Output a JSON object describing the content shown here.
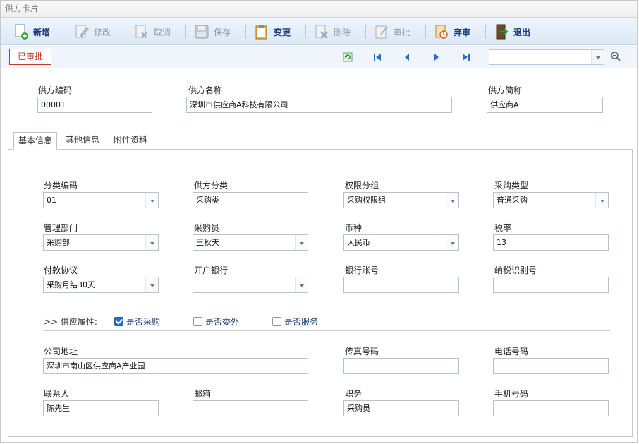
{
  "window": {
    "title": "供方卡片"
  },
  "toolbar": {
    "new": "新增",
    "edit": "修改",
    "cancel": "取消",
    "save": "保存",
    "change": "变更",
    "delete": "删除",
    "approve": "审批",
    "unapprove": "弃审",
    "exit": "退出"
  },
  "status": {
    "badge": "已审批"
  },
  "header": {
    "code_label": "供方编码",
    "code_value": "00001",
    "name_label": "供方名称",
    "name_value": "深圳市供应商A科技有限公司",
    "short_label": "供方简称",
    "short_value": "供应商A"
  },
  "tabs": [
    "基本信息",
    "其他信息",
    "附件资料"
  ],
  "basic": {
    "category_code_label": "分类编码",
    "category_code_value": "01",
    "category_label": "供方分类",
    "category_value": "采购类",
    "perm_group_label": "权限分组",
    "perm_group_value": "采购权限组",
    "purchase_type_label": "采购类型",
    "purchase_type_value": "普通采购",
    "dept_label": "管理部门",
    "dept_value": "采购部",
    "buyer_label": "采购员",
    "buyer_value": "王秋天",
    "currency_label": "币种",
    "currency_value": "人民币",
    "tax_label": "税率",
    "tax_value": "13",
    "payment_label": "付款协议",
    "payment_value": "采购月结30天",
    "bank_label": "开户银行",
    "bank_value": "",
    "account_label": "银行账号",
    "account_value": "",
    "taxid_label": "纳税识别号",
    "taxid_value": "",
    "attr_label": ">> 供应属性:",
    "attr_purchase": "是否采购",
    "attr_outsource": "是否委外",
    "attr_service": "是否服务",
    "address_label": "公司地址",
    "address_value": "深圳市南山区供应商A产业园",
    "fax_label": "传真号码",
    "fax_value": "",
    "phone_label": "电话号码",
    "phone_value": "",
    "contact_label": "联系人",
    "contact_value": "陈先生",
    "email_label": "邮箱",
    "email_value": "",
    "title_label": "职务",
    "title_value": "采购员",
    "mobile_label": "手机号码",
    "mobile_value": ""
  },
  "checkbox_state": {
    "purchase": true,
    "outsource": false,
    "service": false
  },
  "icons": {
    "new": "add-doc-icon",
    "edit": "edit-doc-icon",
    "cancel": "cancel-doc-icon",
    "save": "floppy-icon",
    "change": "clipboard-icon",
    "delete": "delete-doc-icon",
    "approve": "approve-doc-icon",
    "unapprove": "unapprove-doc-icon",
    "exit": "exit-door-icon"
  }
}
